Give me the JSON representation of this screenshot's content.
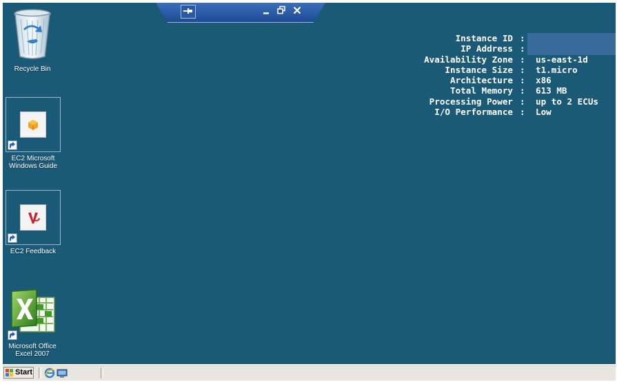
{
  "desktop": {
    "background_color": "#1b5a76",
    "icons": [
      {
        "label": "Recycle Bin",
        "icon": "recycle-bin-icon"
      },
      {
        "label": "EC2 Microsoft Windows Guide",
        "line1": "EC2 Microsoft",
        "line2": "Windows Guide",
        "icon": "ec2-guide-icon"
      },
      {
        "label": "EC2 Feedback",
        "icon": "ec2-feedback-icon"
      },
      {
        "label": "Microsoft Office Excel 2007",
        "line1": "Microsoft Office",
        "line2": "Excel 2007",
        "icon": "excel-icon"
      }
    ]
  },
  "rdp_bar": {
    "buttons": [
      "pin-icon",
      "minimize-icon",
      "restore-icon",
      "close-icon"
    ]
  },
  "instance_info": [
    {
      "key": "Instance ID",
      "value": ""
    },
    {
      "key": "IP Address",
      "value": ""
    },
    {
      "key": "Availability Zone",
      "value": "us-east-1d"
    },
    {
      "key": "Instance Size",
      "value": "t1.micro"
    },
    {
      "key": "Architecture",
      "value": "x86"
    },
    {
      "key": "Total Memory",
      "value": "613 MB"
    },
    {
      "key": "Processing Power",
      "value": "up to 2 ECUs"
    },
    {
      "key": "I/O Performance",
      "value": "Low"
    }
  ],
  "separator": ":",
  "taskbar": {
    "start_label": "Start",
    "quick_launch": [
      "internet-explorer-icon",
      "show-desktop-icon"
    ]
  }
}
